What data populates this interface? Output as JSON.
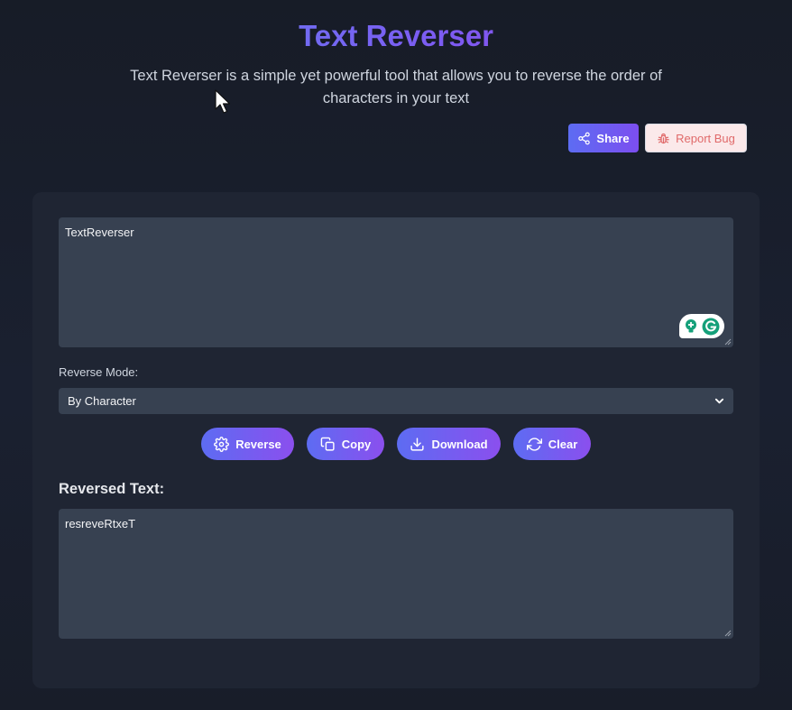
{
  "header": {
    "title": "Text Reverser",
    "subtitle": "Text Reverser is a simple yet powerful tool that allows you to reverse the order of characters in your text"
  },
  "actions_top": {
    "share_label": "Share",
    "report_bug_label": "Report Bug"
  },
  "input": {
    "value": "TextReverser"
  },
  "mode": {
    "label": "Reverse Mode:",
    "selected": "By Character"
  },
  "buttons": {
    "reverse": "Reverse",
    "copy": "Copy",
    "download": "Download",
    "clear": "Clear"
  },
  "output": {
    "heading": "Reversed Text:",
    "value": "resreveRtxeT"
  },
  "colors": {
    "accent_start": "#5d6cf2",
    "accent_end": "#8b4fee",
    "card_bg": "#1f2533",
    "field_bg": "#374151",
    "bug_text": "#e06a6a"
  }
}
